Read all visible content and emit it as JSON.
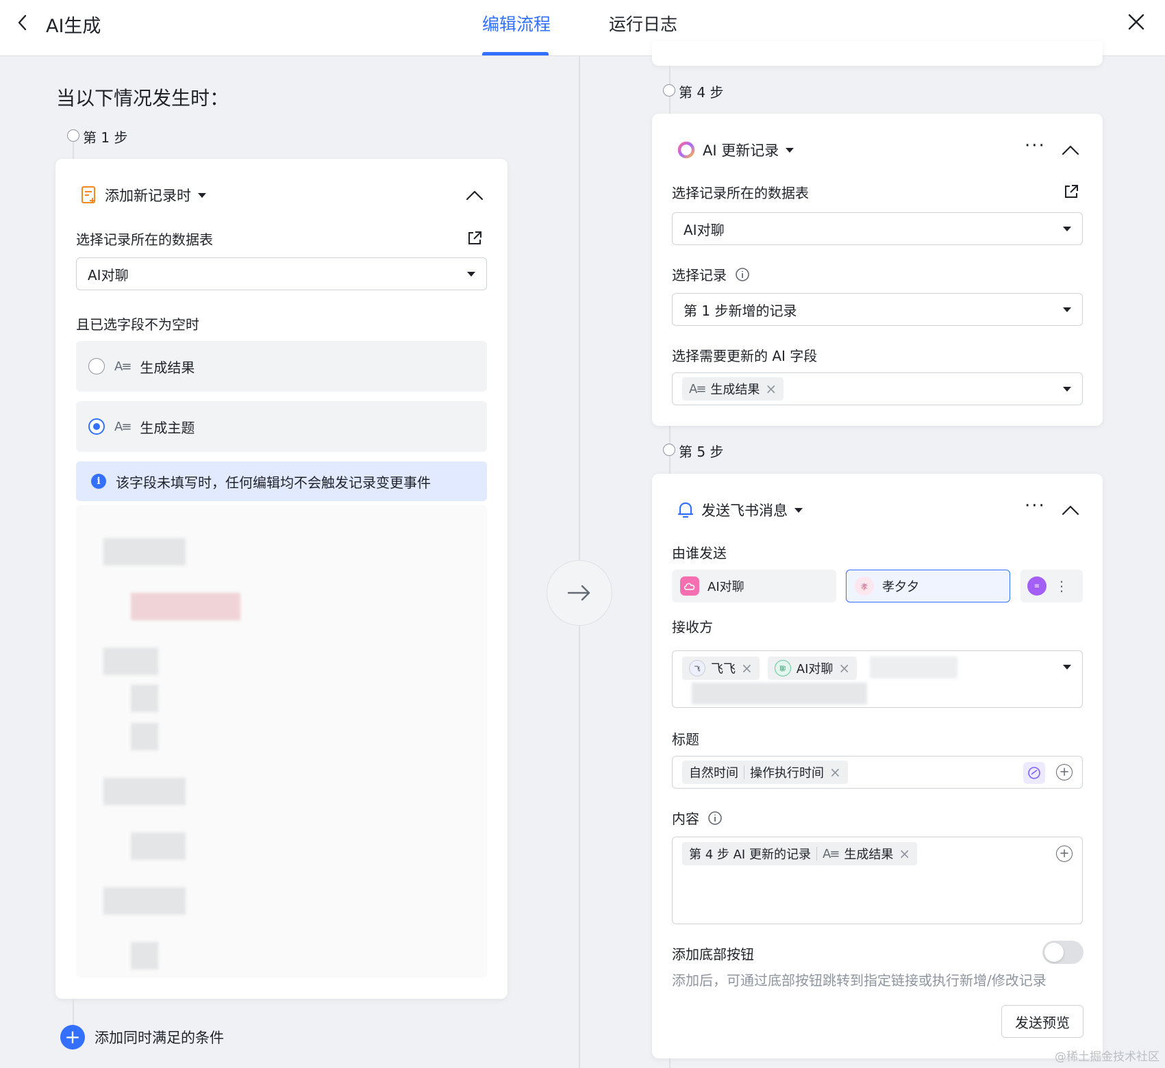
{
  "header": {
    "title": "AI生成",
    "tabs": [
      {
        "label": "编辑流程",
        "active": true
      },
      {
        "label": "运行日志",
        "active": false
      }
    ]
  },
  "left": {
    "heading": "当以下情况发生时：",
    "step1_label": "第 1 步",
    "trigger": {
      "title": "添加新记录时",
      "table_label": "选择记录所在的数据表",
      "table_value": "AI对聊",
      "fields_label": "且已选字段不为空时",
      "options": [
        {
          "label": "生成结果",
          "checked": false
        },
        {
          "label": "生成主题",
          "checked": true
        }
      ],
      "info": "该字段未填写时，任何编辑均不会触发记录变更事件"
    },
    "add_condition": "添加同时满足的条件"
  },
  "right": {
    "step4_label": "第 4 步",
    "update": {
      "title": "AI 更新记录",
      "table_label": "选择记录所在的数据表",
      "table_value": "AI对聊",
      "record_label": "选择记录",
      "record_value": "第 1 步新增的记录",
      "field_label": "选择需要更新的 AI 字段",
      "field_tag": "生成结果"
    },
    "step5_label": "第 5 步",
    "message": {
      "title": "发送飞书消息",
      "sender_label": "由谁发送",
      "sender_app": "AI对聊",
      "sender_user": "孝夕夕",
      "receiver_label": "接收方",
      "receivers": [
        "飞飞",
        "AI对聊"
      ],
      "title_label": "标题",
      "title_tags": [
        "自然时间",
        "操作执行时间"
      ],
      "content_label": "内容",
      "content_tags": [
        "第 4 步 AI 更新的记录",
        "生成结果"
      ],
      "bottom_btn_label": "添加底部按钮",
      "bottom_btn_hint": "添加后，可通过底部按钮跳转到指定链接或执行新增/修改记录",
      "preview_button": "发送预览"
    }
  },
  "watermark": "@稀土掘金技术社区",
  "colors": {
    "accent": "#3370ff",
    "background": "#eff1f4",
    "info_bg": "#e1eaff"
  }
}
